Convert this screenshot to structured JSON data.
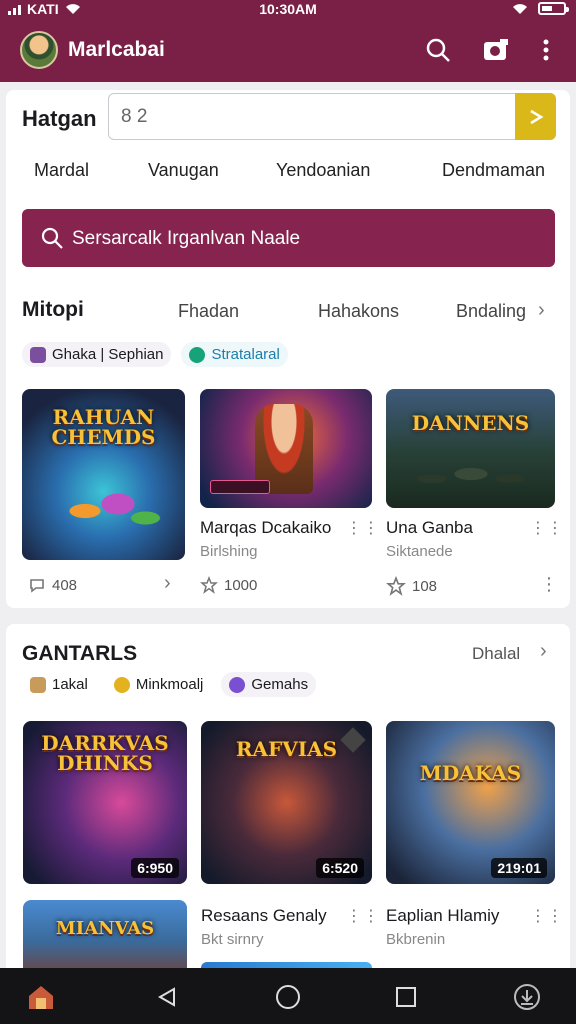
{
  "status_bar": {
    "carrier": "KATI",
    "time": "10:30AM"
  },
  "app_bar": {
    "title": "Marlcabai",
    "icons": [
      "search-icon",
      "camera-icon",
      "more-vert-icon"
    ]
  },
  "search": {
    "label": "Hatgan",
    "value": "8 2",
    "go_icon": "arrow-right-icon"
  },
  "filter_chips": [
    "Mardal",
    "Vanugan",
    "Yendoanian",
    "Dendmaman"
  ],
  "cta": {
    "label": "Sersarcalk Irganlvan Naale",
    "icon": "search-icon"
  },
  "section1": {
    "title": "Mitopi",
    "tabs": [
      "Fhadan",
      "Hahakons",
      "Bndaling"
    ],
    "badges": [
      "Ghaka | Sephian",
      "Stratalaral"
    ],
    "games": [
      {
        "art_title": "RAHUAN\nCHEMDS",
        "name": "",
        "sub": "",
        "meta": "408"
      },
      {
        "art_title": "",
        "name": "Marqas Dcakaiko",
        "sub": "Birlshing",
        "meta": "1000"
      },
      {
        "art_title": "DANNENS",
        "name": "Una Ganba",
        "sub": "Siktanede",
        "meta": "108"
      }
    ]
  },
  "section2": {
    "title": "GANTARLS",
    "link": "Dhalal",
    "badges": [
      "1akal",
      "Minkmoalj",
      "Gemahs"
    ],
    "videos": [
      {
        "art_title": "DARRKVAS\nDHINKS",
        "duration": "6:950"
      },
      {
        "art_title": "RAFVIAS",
        "duration": "6:520"
      },
      {
        "art_title": "MDAKAS",
        "duration": "219:01"
      }
    ],
    "row2": [
      {
        "art_title": "MIANVAS"
      },
      {
        "name": "Resaans Genaly",
        "sub": "Bkt sirnry"
      },
      {
        "name": "Eaplian Hlamiy",
        "sub": "Bkbrenin"
      }
    ]
  },
  "nav_bar": {
    "icons": [
      "home-thumb-icon",
      "back-icon",
      "home-icon",
      "recents-icon",
      "download-icon"
    ]
  },
  "colors": {
    "primary": "#7a1f45",
    "accent": "#dbb81a",
    "cta": "#86244f"
  }
}
